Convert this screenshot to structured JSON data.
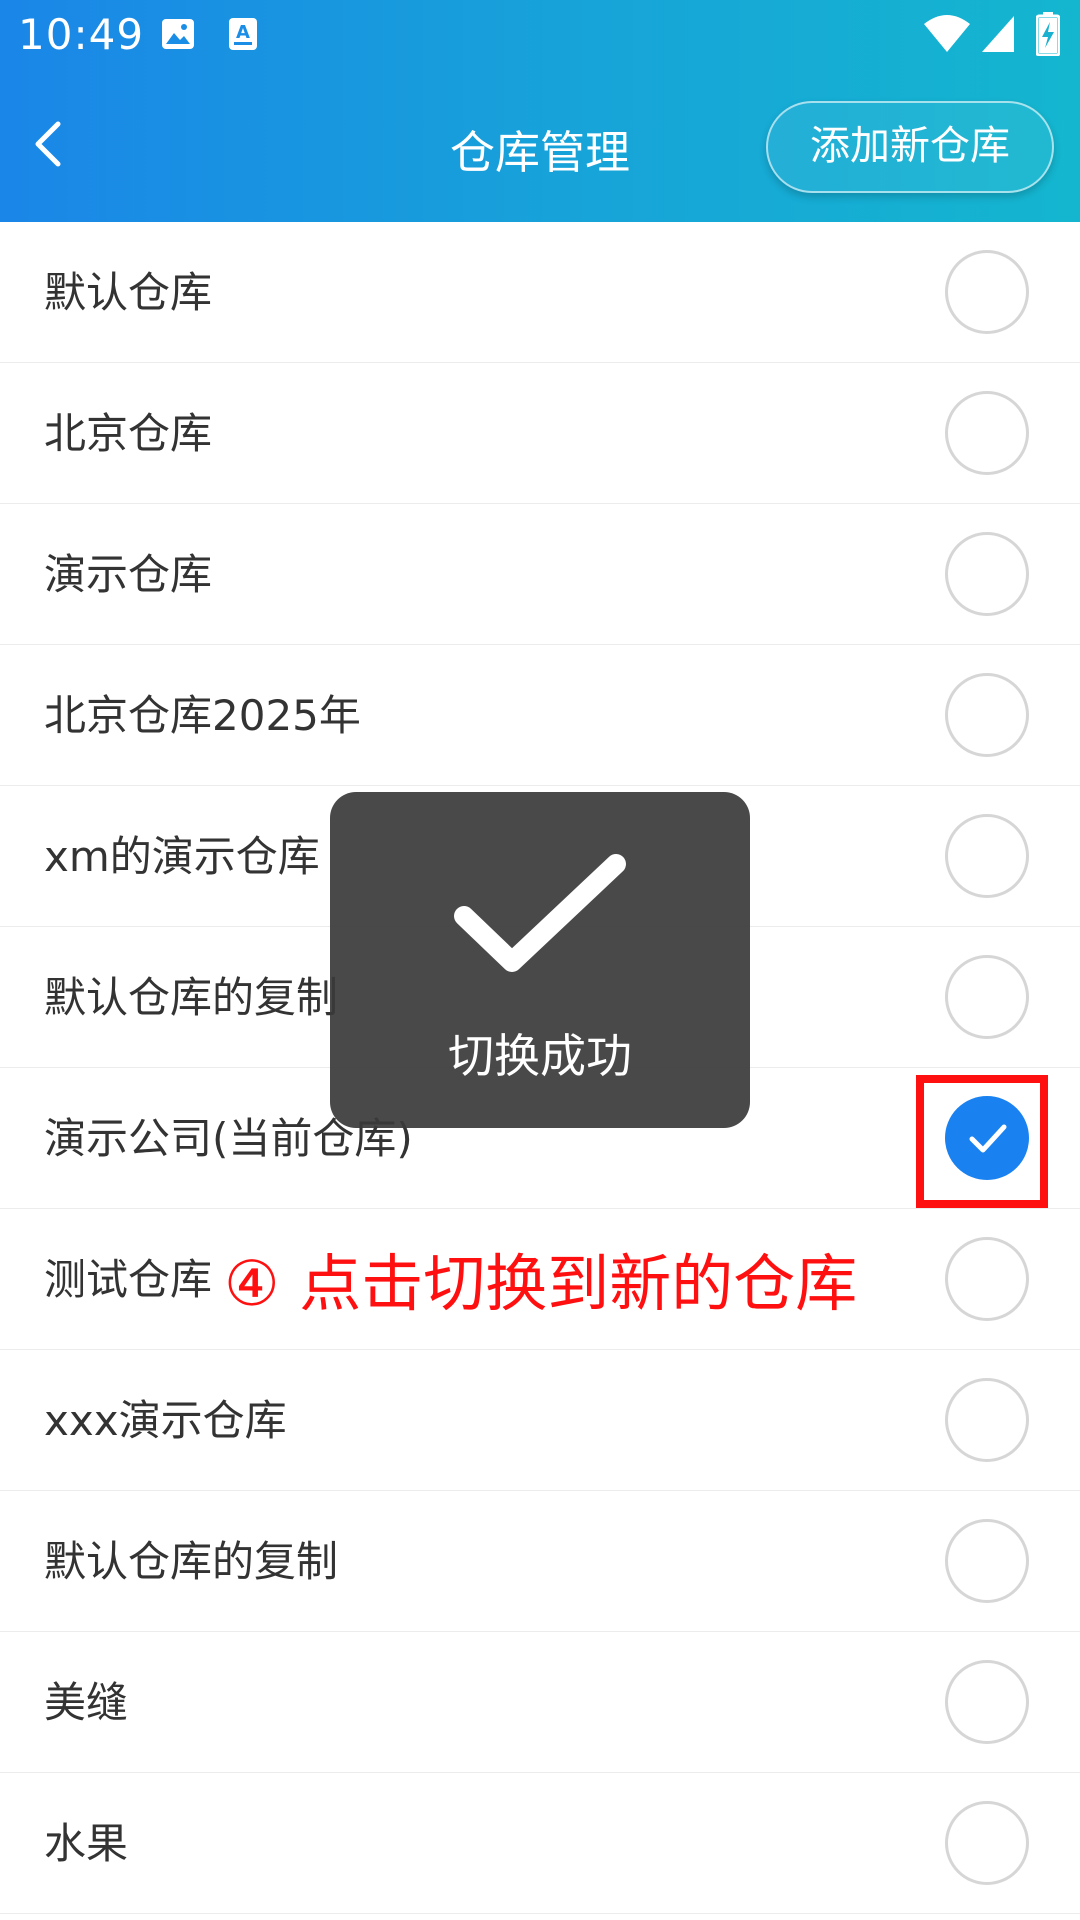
{
  "status_bar": {
    "time": "10:49",
    "icons": [
      "image-icon",
      "keyboard-a-icon",
      "wifi-icon",
      "signal-icon",
      "battery-charging-icon"
    ]
  },
  "header": {
    "title": "仓库管理",
    "back_icon": "chevron-left-icon",
    "add_button_label": "添加新仓库",
    "gradient_colors": [
      "#1a86e8",
      "#14b6cf"
    ]
  },
  "warehouses": [
    {
      "name": "默认仓库",
      "selected": false
    },
    {
      "name": "北京仓库",
      "selected": false
    },
    {
      "name": "演示仓库",
      "selected": false
    },
    {
      "name": "北京仓库2025年",
      "selected": false
    },
    {
      "name": "xm的演示仓库",
      "selected": false
    },
    {
      "name": "默认仓库的复制",
      "selected": false
    },
    {
      "name": "演示公司(当前仓库)",
      "selected": true
    },
    {
      "name": "测试仓库",
      "selected": false
    },
    {
      "name": "xxx演示仓库",
      "selected": false
    },
    {
      "name": "默认仓库的复制",
      "selected": false
    },
    {
      "name": "美缝",
      "selected": false
    },
    {
      "name": "水果",
      "selected": false
    }
  ],
  "toast": {
    "icon": "checkmark-icon",
    "text": "切换成功"
  },
  "annotation": {
    "text": "④ 点击切换到新的仓库",
    "color": "#ff1010"
  },
  "colors": {
    "accent": "#1a82f0",
    "radio_border": "#d6d6d6"
  }
}
